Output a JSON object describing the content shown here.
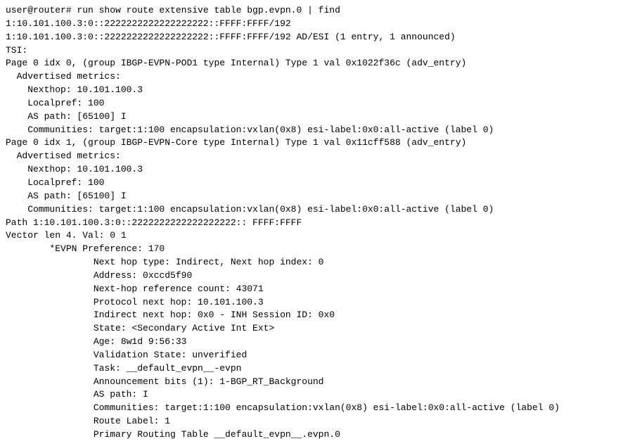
{
  "terminal": {
    "lines": [
      "user@router# run show route extensive table bgp.evpn.0 | find",
      "1:10.101.100.3:0::2222222222222222222::FFFF:FFFF/192",
      "1:10.101.100.3:0::2222222222222222222::FFFF:FFFF/192 AD/ESI (1 entry, 1 announced)",
      "TSI:",
      "Page 0 idx 0, (group IBGP-EVPN-POD1 type Internal) Type 1 val 0x1022f36c (adv_entry)",
      "  Advertised metrics:",
      "    Nexthop: 10.101.100.3",
      "    Localpref: 100",
      "    AS path: [65100] I",
      "    Communities: target:1:100 encapsulation:vxlan(0x8) esi-label:0x0:all-active (label 0)",
      "Page 0 idx 1, (group IBGP-EVPN-Core type Internal) Type 1 val 0x11cff588 (adv_entry)",
      "  Advertised metrics:",
      "    Nexthop: 10.101.100.3",
      "    Localpref: 100",
      "    AS path: [65100] I",
      "    Communities: target:1:100 encapsulation:vxlan(0x8) esi-label:0x0:all-active (label 0)",
      "Path 1:10.101.100.3:0::2222222222222222222:: FFFF:FFFF",
      "Vector len 4. Val: 0 1",
      "        *EVPN Preference: 170",
      "                Next hop type: Indirect, Next hop index: 0",
      "                Address: 0xccd5f90",
      "                Next-hop reference count: 43071",
      "                Protocol next hop: 10.101.100.3",
      "                Indirect next hop: 0x0 - INH Session ID: 0x0",
      "                State: <Secondary Active Int Ext>",
      "                Age: 8w1d 9:56:33",
      "                Validation State: unverified",
      "                Task: __default_evpn__-evpn",
      "                Announcement bits (1): 1-BGP_RT_Background",
      "                AS path: I",
      "                Communities: target:1:100 encapsulation:vxlan(0x8) esi-label:0x0:all-active (label 0)",
      "                Route Label: 1",
      "                Primary Routing Table __default_evpn__.evpn.0"
    ]
  }
}
